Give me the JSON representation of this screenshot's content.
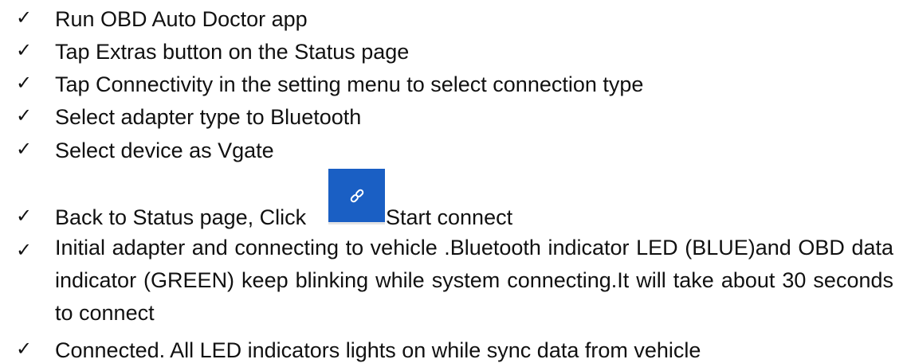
{
  "steps": [
    {
      "text": "Run OBD Auto Doctor app"
    },
    {
      "text": "Tap Extras button on the Status page"
    },
    {
      "text": "Tap Connectivity in the setting menu to select connection type"
    },
    {
      "text": "Select adapter type to Bluetooth"
    },
    {
      "text": "Select device as Vgate"
    },
    {
      "text_before": "Back to Status page, Click",
      "text_after": "Start connect",
      "icon": "link-icon"
    },
    {
      "text": "Initial adapter and connecting to vehicle .Bluetooth indicator LED (BLUE)and OBD data indicator (GREEN) keep blinking while system connecting.It will take about 30 seconds to connect"
    },
    {
      "text": "Connected. All LED indicators lights on while sync data from vehicle"
    }
  ],
  "check_glyph": "✓",
  "colors": {
    "button_bg": "#1a5fc4",
    "icon": "#ffffff",
    "text": "#111111"
  }
}
